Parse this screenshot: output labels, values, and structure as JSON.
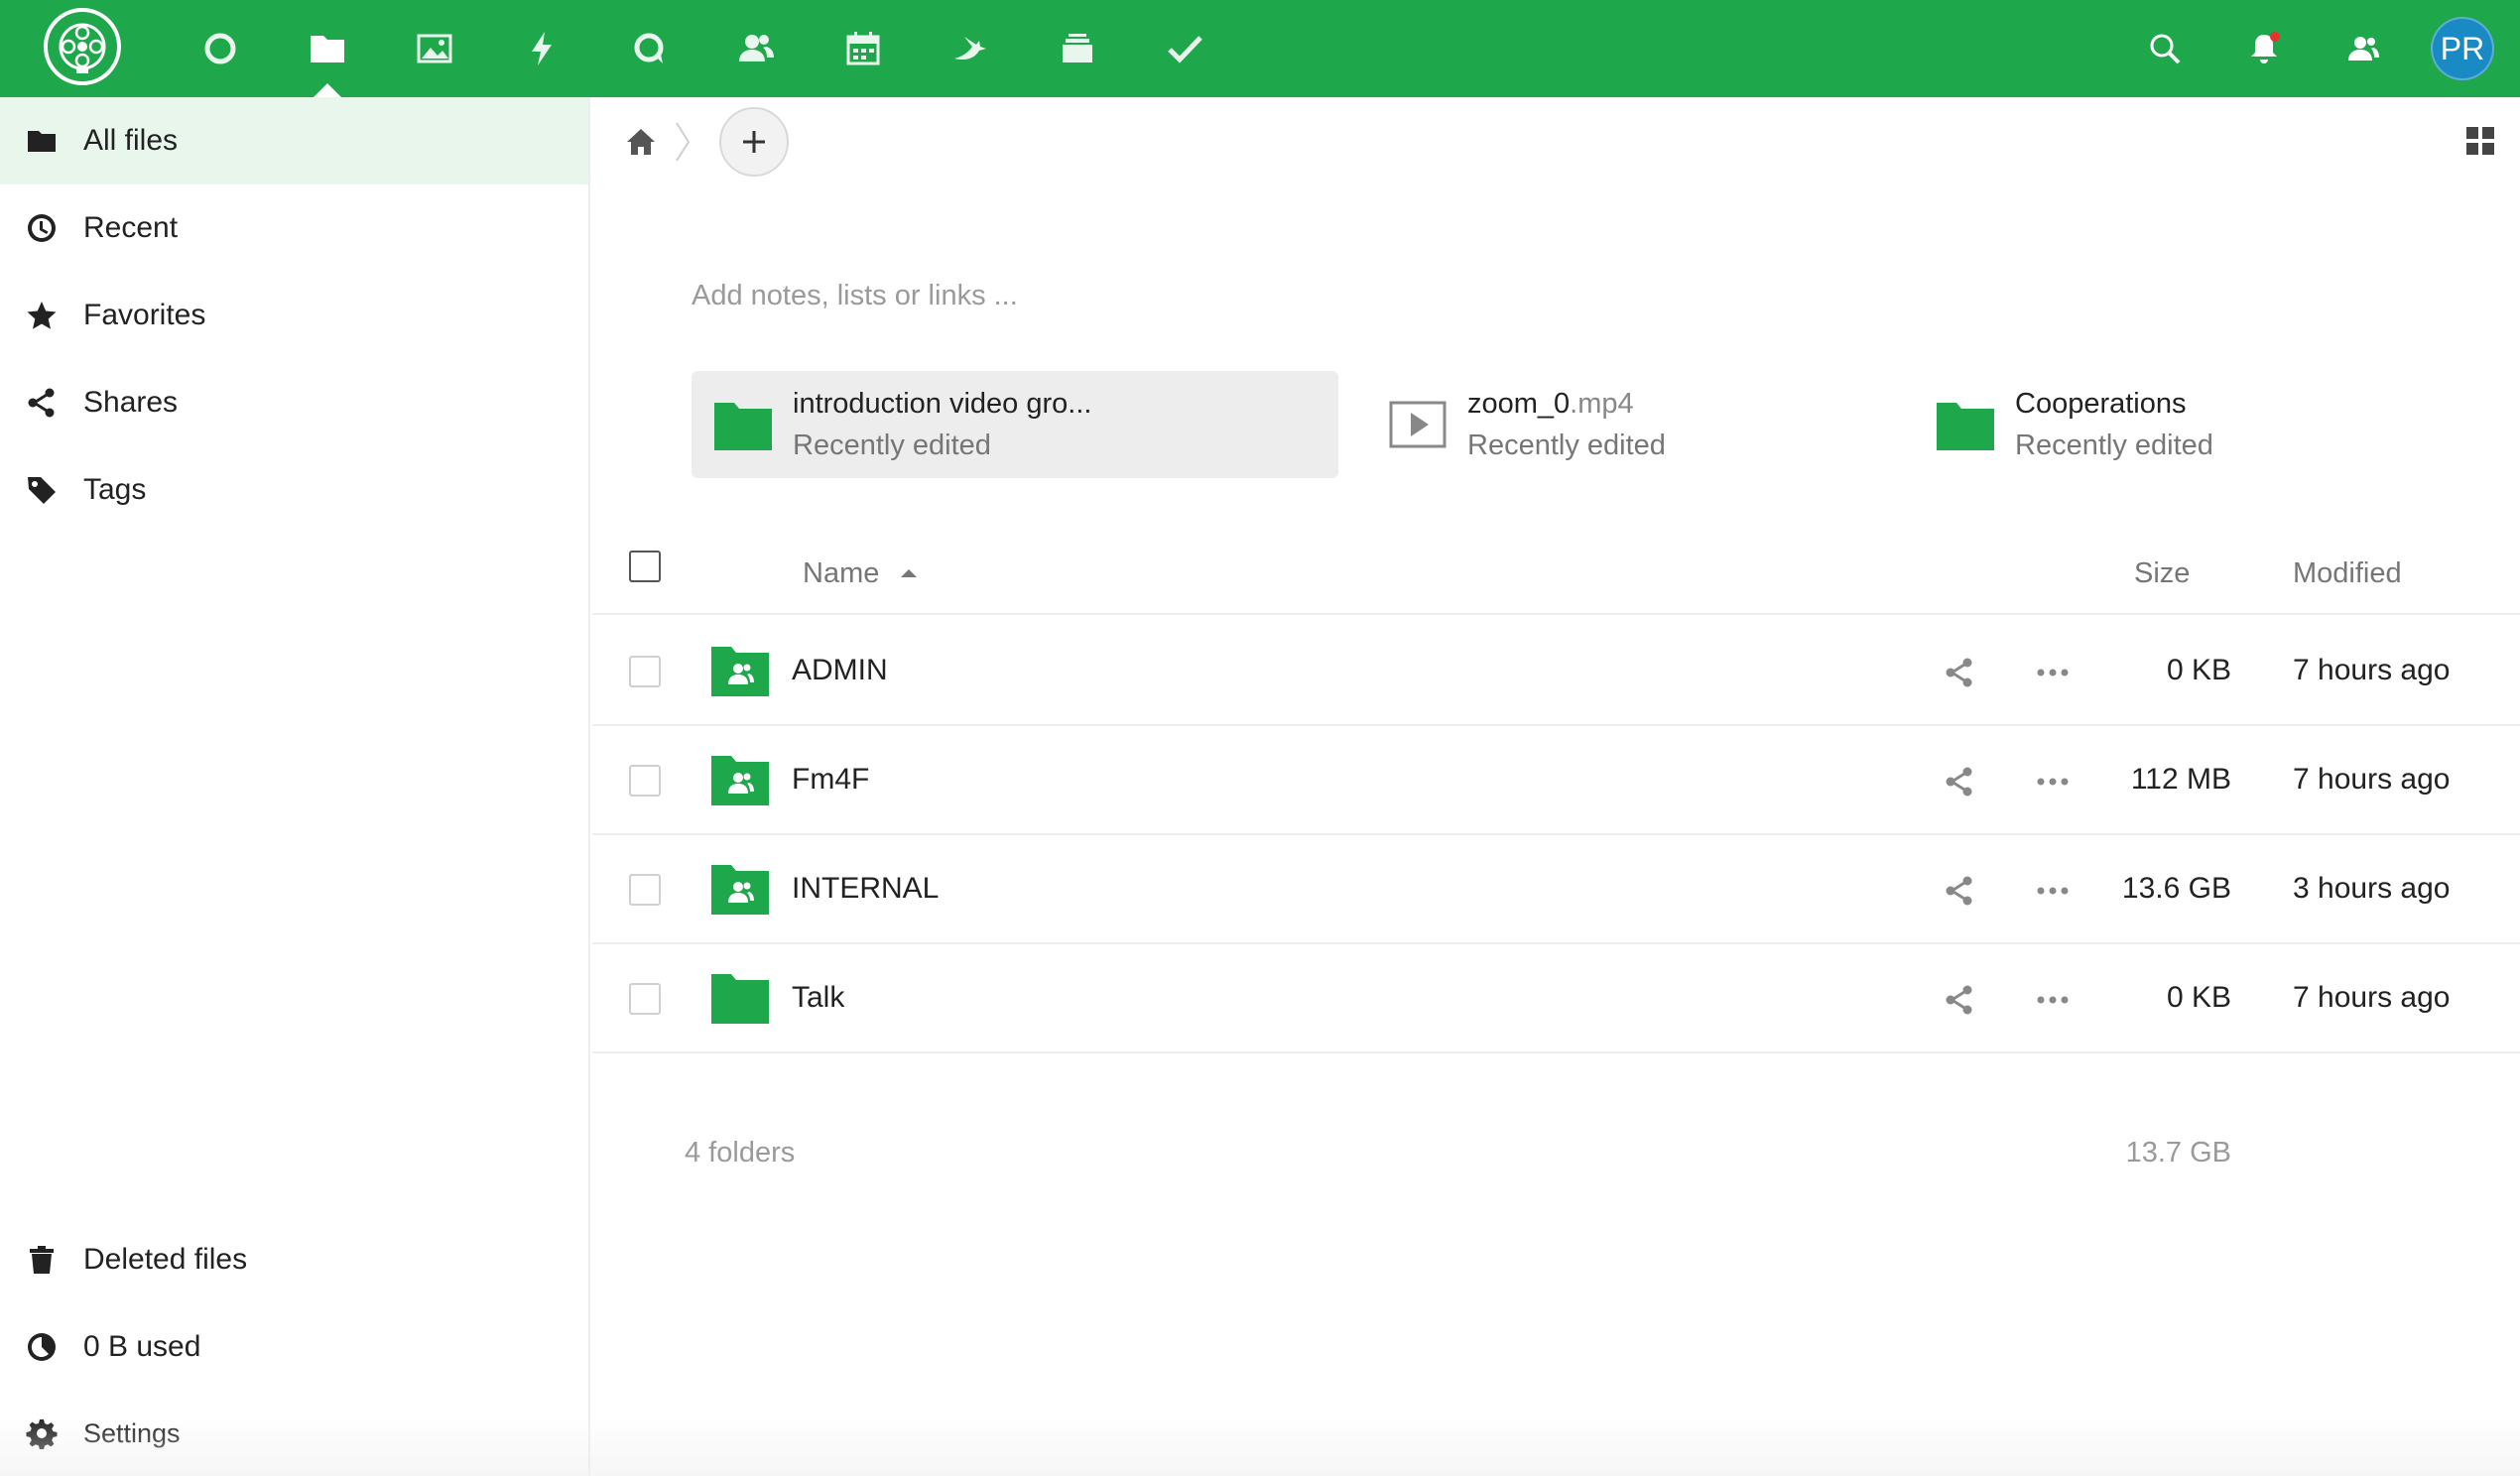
{
  "header": {
    "apps": [
      "dashboard",
      "files",
      "photos",
      "activity",
      "talk",
      "contacts",
      "calendar",
      "mail",
      "deck",
      "tasks"
    ],
    "avatar_initials": "PR",
    "brand_color": "#1fa84b"
  },
  "sidebar": {
    "items": [
      {
        "label": "All files",
        "icon": "folder-icon"
      },
      {
        "label": "Recent",
        "icon": "clock-icon"
      },
      {
        "label": "Favorites",
        "icon": "star-icon"
      },
      {
        "label": "Shares",
        "icon": "share-icon"
      },
      {
        "label": "Tags",
        "icon": "tag-icon"
      }
    ],
    "deleted_label": "Deleted files",
    "quota_label": "0 B used",
    "settings_label": "Settings"
  },
  "main": {
    "notes_placeholder": "Add notes, lists or links ...",
    "recent": [
      {
        "name": "introduction video gro...",
        "ext": "",
        "sub": "Recently edited",
        "type": "folder"
      },
      {
        "name": "zoom_0",
        "ext": ".mp4",
        "sub": "Recently edited",
        "type": "video"
      },
      {
        "name": "Cooperations",
        "ext": "",
        "sub": "Recently edited",
        "type": "folder"
      }
    ],
    "columns": {
      "name": "Name",
      "size": "Size",
      "modified": "Modified"
    },
    "files": [
      {
        "name": "ADMIN",
        "size": "0 KB",
        "modified": "7 hours ago",
        "shared": true
      },
      {
        "name": "Fm4F",
        "size": "112 MB",
        "modified": "7 hours ago",
        "shared": true
      },
      {
        "name": "INTERNAL",
        "size": "13.6 GB",
        "modified": "3 hours ago",
        "shared": true
      },
      {
        "name": "Talk",
        "size": "0 KB",
        "modified": "7 hours ago",
        "shared": false
      }
    ],
    "summary": {
      "count": "4 folders",
      "size": "13.7 GB"
    }
  }
}
